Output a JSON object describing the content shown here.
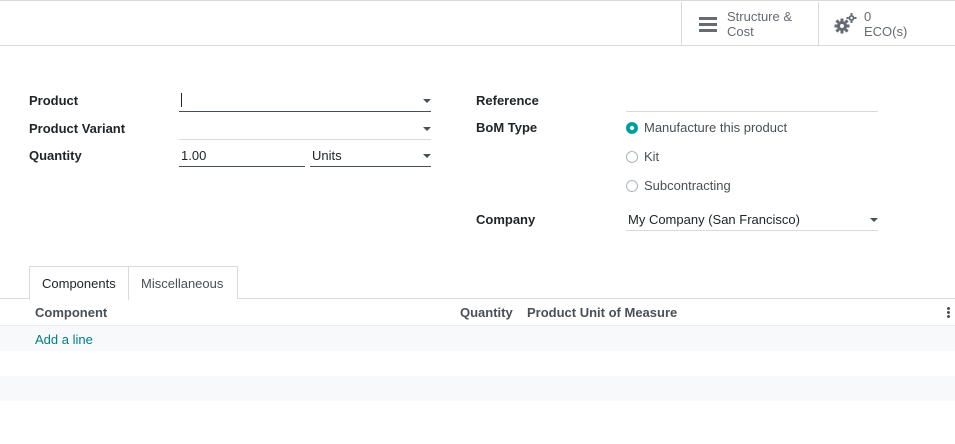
{
  "stat_buttons": {
    "structure": {
      "line1": "Structure &",
      "line2": "Cost",
      "icon": "bars-icon"
    },
    "eco": {
      "line1": "0",
      "line2": "ECO(s)",
      "icon": "gears-icon"
    }
  },
  "form": {
    "product": {
      "label": "Product",
      "value": ""
    },
    "product_variant": {
      "label": "Product Variant",
      "value": ""
    },
    "quantity": {
      "label": "Quantity",
      "value": "1.00",
      "uom": "Units"
    },
    "reference": {
      "label": "Reference",
      "value": ""
    },
    "bom_type": {
      "label": "BoM Type",
      "options": [
        {
          "label": "Manufacture this product",
          "checked": true
        },
        {
          "label": "Kit",
          "checked": false
        },
        {
          "label": "Subcontracting",
          "checked": false
        }
      ]
    },
    "company": {
      "label": "Company",
      "value": "My Company (San Francisco)"
    }
  },
  "tabs": [
    {
      "label": "Components",
      "active": true
    },
    {
      "label": "Miscellaneous",
      "active": false
    }
  ],
  "table": {
    "columns": [
      "Component",
      "Quantity",
      "Product Unit of Measure"
    ],
    "add_line": "Add a line"
  },
  "colors": {
    "accent": "#00a09d",
    "link": "#017e84",
    "border": "#d8dadd"
  }
}
